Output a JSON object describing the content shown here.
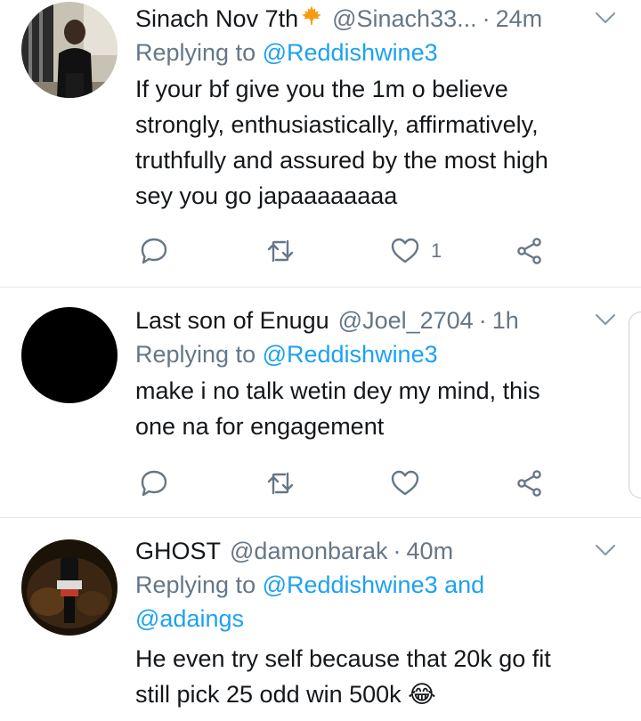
{
  "tweets": [
    {
      "name": "Sinach Nov 7th",
      "handle": "@Sinach33...",
      "time": "24m",
      "replying_prefix": "Replying to ",
      "replying_to": "@Reddishwine3",
      "text_lines": [
        "If your bf give you the 1m o believe",
        "strongly, enthusiastically, affirmatively,",
        "truthfully and assured by the most high",
        "sey you go japaaaaaaaa"
      ],
      "like_count": "1"
    },
    {
      "name": "Last son of Enugu",
      "handle": "@Joel_2704",
      "time": "1h",
      "replying_prefix": "Replying to ",
      "replying_to": "@Reddishwine3",
      "text_lines": [
        "make i no talk wetin dey my mind, this",
        "one na for engagement"
      ],
      "like_count": ""
    },
    {
      "name": "GHOST",
      "handle": "@damonbarak",
      "time": "40m",
      "replying_prefix": "Replying to ",
      "replying_to_line1": "@Reddishwine3 and",
      "replying_to_line2": "@adaings",
      "text_lines": [
        "He even try self because that 20k go fit",
        "still pick 25 odd win 500k 😂"
      ]
    }
  ],
  "separator": "·",
  "icons": {
    "leaf": "maple-leaf-icon",
    "reply": "reply-icon",
    "retweet": "retweet-icon",
    "like": "heart-icon",
    "share": "share-icon",
    "more": "chevron-down-icon"
  },
  "colors": {
    "text": "#14171a",
    "muted": "#657786",
    "link": "#1da1f2",
    "divider": "#e1e8ed"
  }
}
